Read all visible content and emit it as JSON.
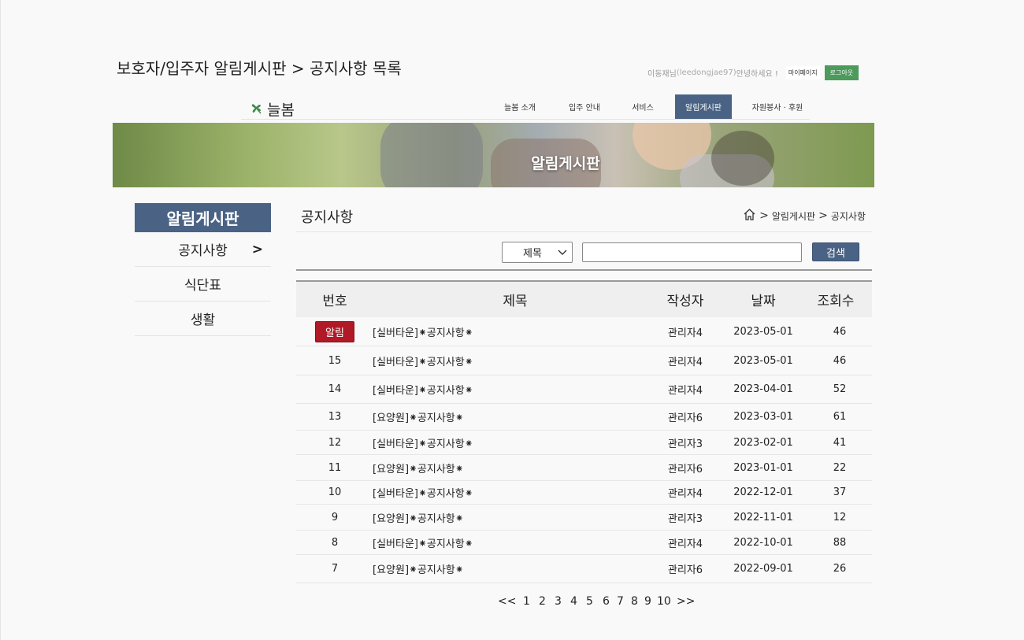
{
  "page": {
    "heading": "보호자/입주자 알림게시판 > 공지사항 목록"
  },
  "user_bar": {
    "greeting_prefix": "이동재님",
    "greeting_id": "(leedongjae97)",
    "greeting_suffix": " 안녕하세요 !",
    "mypage_label": "마이페이지",
    "logout_label": "로그아웃",
    "logout_color": "#4c9a5c"
  },
  "nav": {
    "logo_text": "늘봄",
    "items": [
      {
        "label": "늘봄 소개"
      },
      {
        "label": "입주 안내"
      },
      {
        "label": "서비스"
      },
      {
        "label": "알림게시판"
      },
      {
        "label": "자원봉사 · 후원"
      }
    ],
    "active_color": "#4a6385"
  },
  "banner": {
    "title": "알림게시판"
  },
  "sidebar": {
    "title": "알림게시판",
    "items": [
      {
        "label": "공지사항",
        "chevron": ">"
      },
      {
        "label": "식단표"
      },
      {
        "label": "생활"
      }
    ]
  },
  "content": {
    "title": "공지사항",
    "breadcrumb": {
      "sep1": ">",
      "level1": "알림게시판",
      "sep2": ">",
      "level2": "공지사항"
    },
    "search": {
      "select_value": "제목",
      "input_value": "",
      "button_label": "검색"
    }
  },
  "table": {
    "headers": {
      "no": "번호",
      "title": "제목",
      "writer": "작성자",
      "date": "날짜",
      "views": "조회수"
    },
    "rows": [
      {
        "no": "알림",
        "title": "[실버타운]⁕공지사항⁕",
        "writer": "관리자4",
        "date": "2023-05-01",
        "views": "46"
      },
      {
        "no": "15",
        "title": "[실버타운]⁕공지사항⁕",
        "writer": "관리자4",
        "date": "2023-05-01",
        "views": "46"
      },
      {
        "no": "14",
        "title": "[실버타운]⁕공지사항⁕",
        "writer": "관리자4",
        "date": "2023-04-01",
        "views": "52"
      },
      {
        "no": "13",
        "title": "[요양원]⁕공지사항⁕",
        "writer": "관리자6",
        "date": "2023-03-01",
        "views": "61"
      },
      {
        "no": "12",
        "title": "[실버타운]⁕공지사항⁕",
        "writer": "관리자3",
        "date": "2023-02-01",
        "views": "41"
      },
      {
        "no": "11",
        "title": "[요양원]⁕공지사항⁕",
        "writer": "관리자6",
        "date": "2023-01-01",
        "views": "22"
      },
      {
        "no": "10",
        "title": "[실버타운]⁕공지사항⁕",
        "writer": "관리자4",
        "date": "2022-12-01",
        "views": "37"
      },
      {
        "no": "9",
        "title": "[요양원]⁕공지사항⁕",
        "writer": "관리자3",
        "date": "2022-11-01",
        "views": "12"
      },
      {
        "no": "8",
        "title": "[실버타운]⁕공지사항⁕",
        "writer": "관리자4",
        "date": "2022-10-01",
        "views": "88"
      },
      {
        "no": "7",
        "title": "[요양원]⁕공지사항⁕",
        "writer": "관리자6",
        "date": "2022-09-01",
        "views": "26"
      }
    ],
    "badge_color": "#b01a26"
  },
  "pager": {
    "first": "<<",
    "pages": [
      "1",
      "2",
      "3",
      "4",
      "5",
      "6",
      "7",
      "8",
      "9",
      "10"
    ],
    "last": ">>"
  }
}
